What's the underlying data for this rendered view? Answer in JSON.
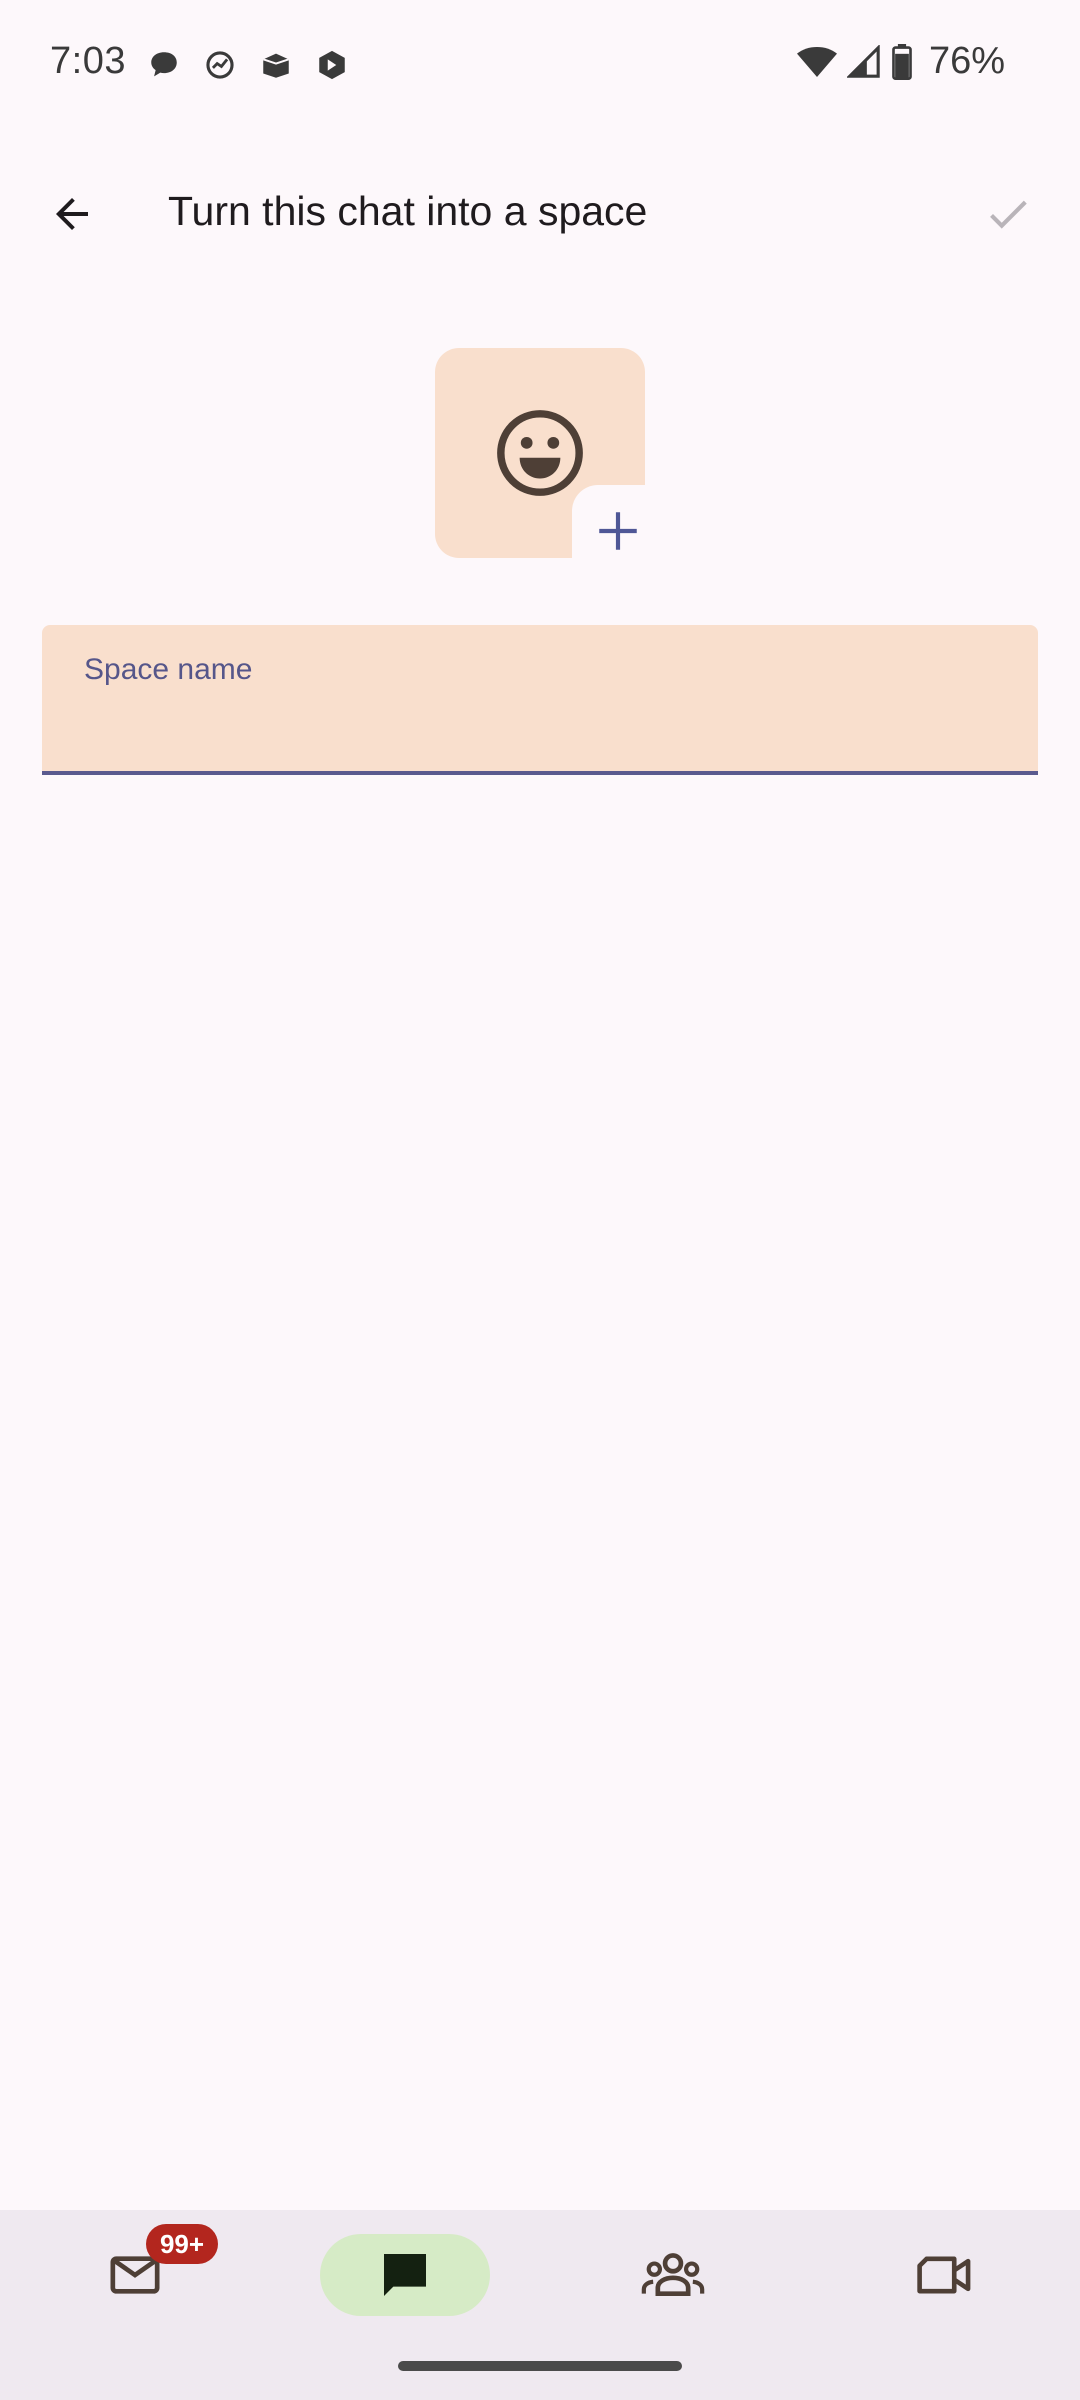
{
  "status_bar": {
    "time": "7:03",
    "notification_icons": [
      "chat-bubble-icon",
      "activity-icon",
      "archive-box-icon",
      "hexagon-app-icon"
    ],
    "battery_percent": "76%",
    "wifi": "wifi-icon",
    "signal": "signal-icon"
  },
  "app_bar": {
    "title": "Turn this chat into a space",
    "back_icon": "arrow-back-icon",
    "confirm_icon": "check-icon",
    "confirm_enabled": false
  },
  "avatar_picker": {
    "emoji_icon": "smiley-face-icon",
    "add_icon": "plus-icon"
  },
  "space_name_field": {
    "label": "Space name",
    "value": ""
  },
  "bottom_nav": {
    "items": [
      {
        "name": "mail",
        "icon": "mail-icon",
        "badge": "99+",
        "selected": false
      },
      {
        "name": "chat",
        "icon": "chat-icon",
        "selected": true
      },
      {
        "name": "spaces",
        "icon": "people-icon",
        "selected": false
      },
      {
        "name": "meet",
        "icon": "video-icon",
        "selected": false
      }
    ]
  },
  "colors": {
    "background": "#fdf8fb",
    "avatar_bg": "#f9dfcd",
    "accent": "#56568a",
    "nav_bg": "#efe9f0",
    "nav_selected": "#d6ebc6",
    "badge": "#b3261e"
  }
}
